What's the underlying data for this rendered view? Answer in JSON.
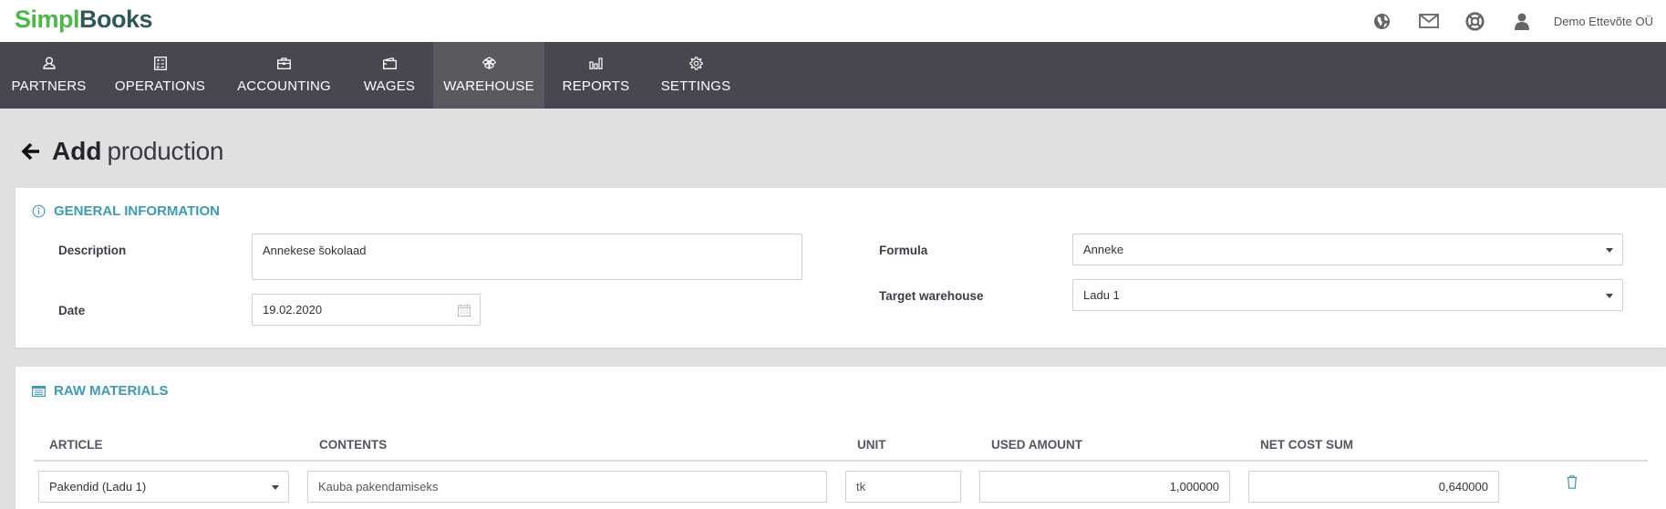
{
  "app": {
    "logo_part1": "Simpl",
    "logo_part2": "Books",
    "brand_colors": {
      "green": "#4cb848",
      "dark": "#2d5a58",
      "accent": "#3a9bb5",
      "nav_bg": "#48474f",
      "nav_active": "#5a5960"
    }
  },
  "header": {
    "icons": [
      "globe-icon",
      "mail-icon",
      "help-lifebuoy-icon",
      "user-icon"
    ],
    "company": "Demo Ettevõte OÜ"
  },
  "nav": {
    "items": [
      {
        "label": "PARTNERS",
        "icon": "partner-icon",
        "active": false
      },
      {
        "label": "OPERATIONS",
        "icon": "operations-icon",
        "active": false
      },
      {
        "label": "ACCOUNTING",
        "icon": "briefcase-icon",
        "active": false
      },
      {
        "label": "WAGES",
        "icon": "wallet-icon",
        "active": false
      },
      {
        "label": "WAREHOUSE",
        "icon": "boxes-icon",
        "active": true
      },
      {
        "label": "REPORTS",
        "icon": "bar-chart-icon",
        "active": false
      },
      {
        "label": "SETTINGS",
        "icon": "gear-icon",
        "active": false
      }
    ]
  },
  "page": {
    "title_bold": "Add",
    "title_light": "production"
  },
  "general": {
    "title": "GENERAL INFORMATION",
    "description_label": "Description",
    "description_value": "Annekese šokolaad",
    "date_label": "Date",
    "date_value": "19.02.2020",
    "formula_label": "Formula",
    "formula_value": "Anneke",
    "target_warehouse_label": "Target warehouse",
    "target_warehouse_value": "Ladu 1"
  },
  "raw_materials": {
    "title": "RAW MATERIALS",
    "columns": [
      "ARTICLE",
      "CONTENTS",
      "UNIT",
      "USED AMOUNT",
      "NET COST SUM"
    ],
    "rows": [
      {
        "article": "Pakendid (Ladu 1)",
        "contents": "Kauba pakendamiseks",
        "unit": "tk",
        "used_amount": "1,000000",
        "net_cost_sum": "0,640000"
      }
    ]
  }
}
